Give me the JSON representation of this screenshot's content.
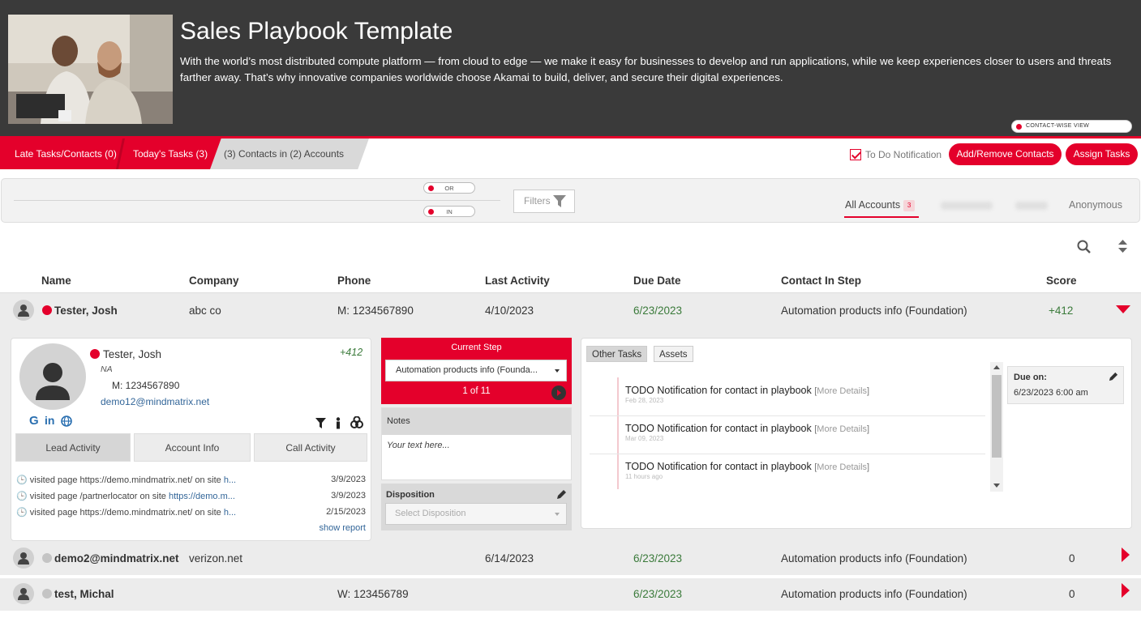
{
  "header": {
    "title": "Sales Playbook Template",
    "description": "With the world’s most distributed compute platform — from cloud to edge — we make it easy for businesses to develop and run applications, while we keep experiences closer to users and threats farther away. That’s why innovative companies worldwide choose Akamai to build, deliver, and secure their digital experiences.",
    "view_toggle": "CONTACT-WISE VIEW"
  },
  "taskbar": {
    "late": "Late Tasks/Contacts (0)",
    "today": "Today's Tasks (3)",
    "contacts": "(3) Contacts in (2) Accounts",
    "todo_label": "To Do Notification",
    "add_remove": "Add/Remove Contacts",
    "assign": "Assign Tasks"
  },
  "filterbar": {
    "or": "OR",
    "in": "IN",
    "filters": "Filters",
    "all_accounts": "All Accounts",
    "all_accounts_count": "3",
    "anonymous": "Anonymous"
  },
  "table": {
    "headers": [
      "Name",
      "Company",
      "Phone",
      "Last Activity",
      "Due Date",
      "Contact In Step",
      "Score"
    ],
    "rows": [
      {
        "name": "Tester, Josh",
        "company": "abc co",
        "phone": "M: 1234567890",
        "last": "4/10/2023",
        "due": "6/23/2023",
        "step": "Automation products info (Foundation)",
        "score": "+412",
        "status_color": "#e4002b"
      },
      {
        "name": "demo2@mindmatrix.net",
        "company": "verizon.net",
        "phone": "",
        "last": "6/14/2023",
        "due": "6/23/2023",
        "step": "Automation products info (Foundation)",
        "score": "0",
        "status_color": "#c4c4c4"
      },
      {
        "name": "test, Michal",
        "company": "",
        "phone": "W: 123456789",
        "last": "",
        "due": "6/23/2023",
        "step": "Automation products info (Foundation)",
        "score": "0",
        "status_color": "#c4c4c4"
      }
    ]
  },
  "detail": {
    "name": "Tester, Josh",
    "score": "+412",
    "na": "NA",
    "phone": "M: 1234567890",
    "email": "demo12@mindmatrix.net",
    "tabs": [
      "Lead Activity",
      "Account Info",
      "Call Activity"
    ],
    "activities": [
      {
        "text": "visited page  https://demo.mindmatrix.net/  on site ",
        "site": "h...",
        "date": "3/9/2023"
      },
      {
        "text": "visited page  /partnerlocator  on site ",
        "site": "https://demo.m...",
        "date": "3/9/2023"
      },
      {
        "text": "visited page  https://demo.mindmatrix.net/  on site ",
        "site": "h...",
        "date": "2/15/2023"
      }
    ],
    "show_report": "show report"
  },
  "step": {
    "title": "Current Step",
    "selected": "Automation products info (Founda...",
    "counter": "1 of 11",
    "notes_title": "Notes",
    "notes_placeholder": "Your text here...",
    "disposition_title": "Disposition",
    "disposition_placeholder": "Select Disposition"
  },
  "tasks": {
    "tab_other": "Other Tasks",
    "tab_assets": "Assets",
    "items": [
      {
        "title": "TODO Notification for contact in playbook",
        "more": "More Details",
        "when": "Feb 28, 2023"
      },
      {
        "title": "TODO Notification for contact in playbook",
        "more": "More Details",
        "when": "Mar 09, 2023"
      },
      {
        "title": "TODO Notification for contact in playbook",
        "more": "More Details",
        "when": "11 hours ago"
      }
    ],
    "due_label": "Due on:",
    "due_value": "6/23/2023 6:00 am"
  },
  "colors": {
    "brand_red": "#e4002b",
    "dark_header": "#3a3a3a",
    "score_green": "#3a7a3a"
  }
}
